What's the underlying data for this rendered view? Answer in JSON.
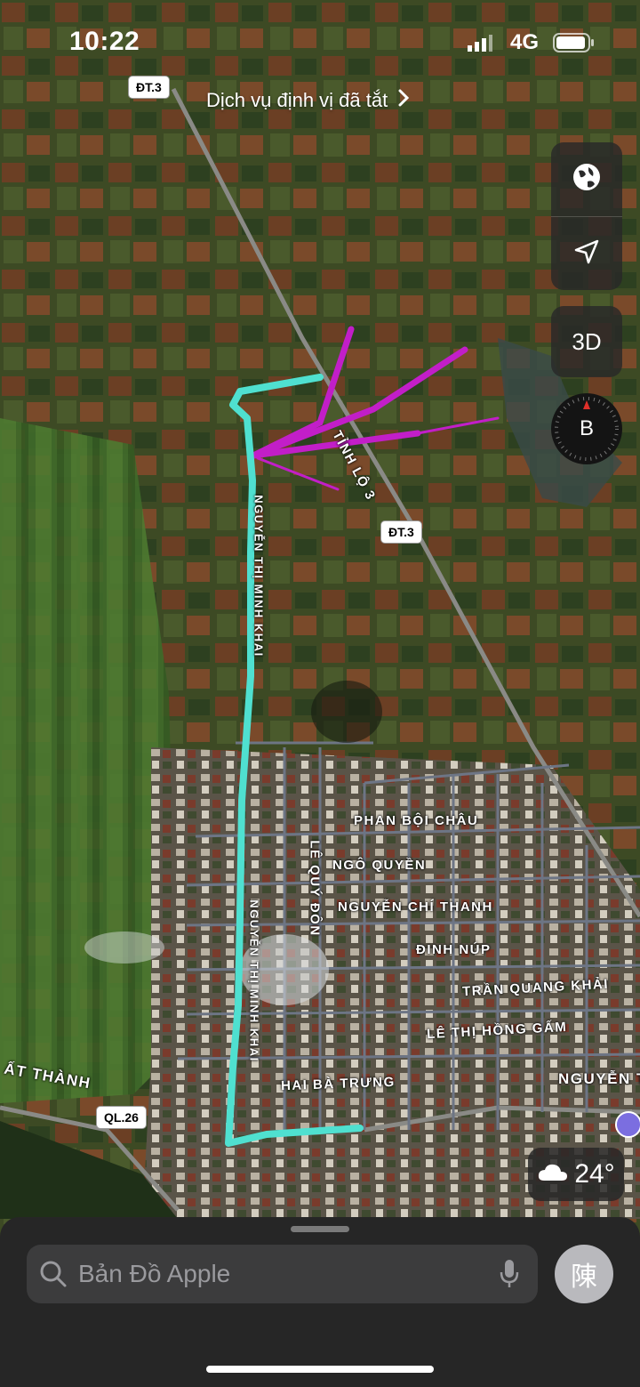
{
  "status_bar": {
    "time": "10:22",
    "network": "4G"
  },
  "location_banner": {
    "text": "Dịch vụ định vị đã tắt"
  },
  "controls": {
    "three_d_label": "3D",
    "compass_label": "B"
  },
  "road_badges": {
    "dt3_top": "ĐT.3",
    "dt3_mid": "ĐT.3",
    "ql26": "QL.26"
  },
  "streets": {
    "tinh_lo_3": "TỈNH LỘ 3",
    "phan_boi_chau": "PHAN BỘI CHÂU",
    "ngo_quyen": "NGÔ QUYỀN",
    "le_quy_don": "LÊ QUÝ ĐÔN",
    "nguyen_chi_thanh": "NGUYỄN CHÍ THANH",
    "dinh_nup": "ĐINH NÚP",
    "tran_quang_khai": "TRẦN QUANG KHẢI",
    "le_thi_hong_gam": "LÊ THỊ HỒNG GẤM",
    "hai_ba_trung": "HAI BÀ TRƯNG",
    "nguyen_right": "NGUYỄN T",
    "tat_thanh": "ẤT THÀNH",
    "nguyen_thi_minh_khai_upper": "NGUYỄN THỊ MINH KHAI",
    "nguyen_thi_minh_khai_lower": "NGUYỄN THỊ MINH KHAI"
  },
  "weather": {
    "temperature": "24°",
    "icon": "cloud-icon"
  },
  "search": {
    "placeholder": "Bản Đồ Apple",
    "avatar_initial": "陳"
  },
  "colors": {
    "route_cyan": "#4fe0d0",
    "route_magenta": "#c21ec8"
  }
}
